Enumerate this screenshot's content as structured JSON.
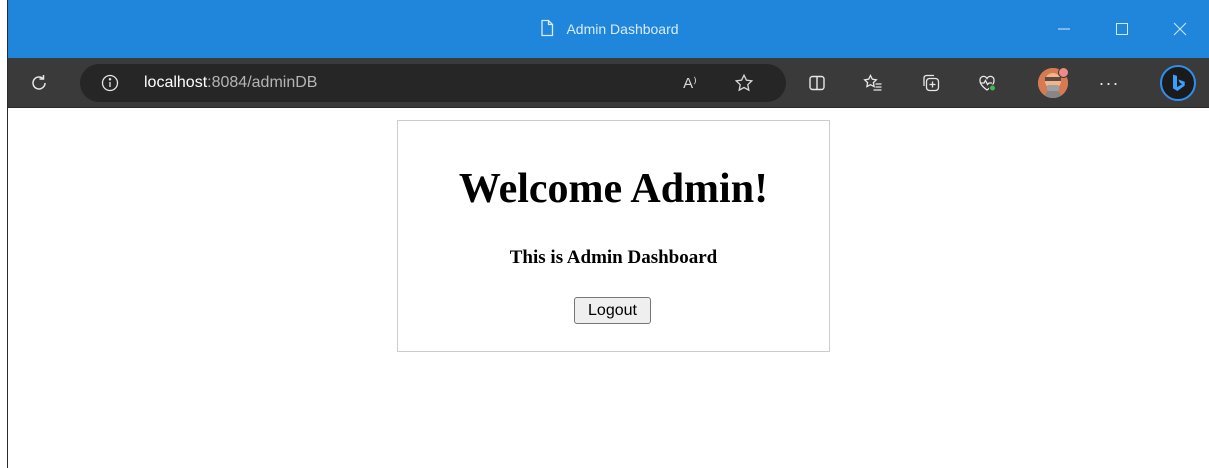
{
  "window": {
    "title": "Admin Dashboard"
  },
  "addressbar": {
    "url_host": "localhost",
    "url_rest": ":8084/adminDB",
    "read_aloud_label": "A⁾"
  },
  "toolbar": {
    "more_label": "···"
  },
  "page": {
    "heading": "Welcome Admin!",
    "subheading": "This is Admin Dashboard",
    "logout_label": "Logout"
  },
  "colors": {
    "titlebar": "#1f86dc",
    "toolbar": "#3a3a3a",
    "addressbar": "#262626",
    "card_border": "#cccccc"
  }
}
